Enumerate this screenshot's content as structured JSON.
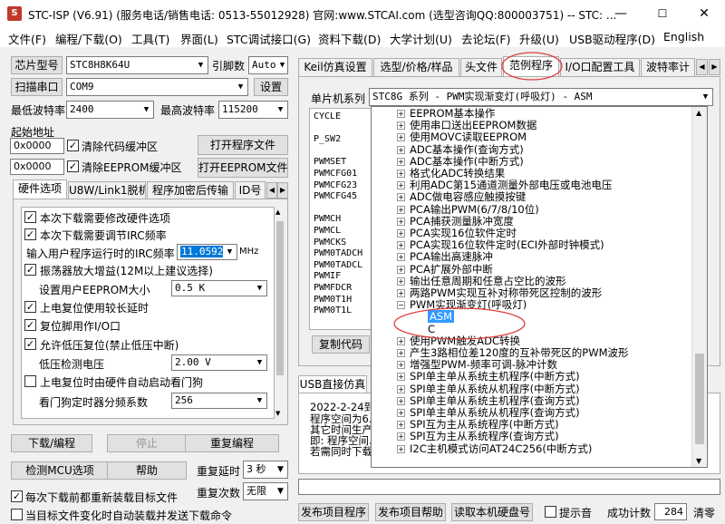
{
  "window": {
    "title": "STC-ISP (V6.91) (服务电话/销售电话: 0513-55012928) 官网:www.STCAI.com  (选型咨询QQ:800003751) -- STC: ...",
    "min": "—",
    "max": "☐",
    "close": "✕"
  },
  "menu": [
    "文件(F)",
    "编程/下载(O)",
    "工具(T)",
    "界面(L)",
    "STC调试接口(G)",
    "资料下载(D)",
    "大学计划(U)",
    "去论坛(F)",
    "升级(U)",
    "USB驱动程序(D)",
    "English"
  ],
  "left": {
    "chip_model_btn": "芯片型号",
    "chip_model": "STC8H8K64U",
    "pin_count_label": "引脚数",
    "pin_count": "Auto",
    "scan_port_btn": "扫描串口",
    "port": "COM9",
    "settings_btn": "设置",
    "min_baud_label": "最低波特率",
    "min_baud": "2400",
    "max_baud_label": "最高波特率",
    "max_baud": "115200",
    "start_addr_label": "起始地址",
    "addr1": "0x0000",
    "clear_code_buf": "清除代码缓冲区",
    "open_prog_btn": "打开程序文件",
    "addr2": "0x0000",
    "clear_eeprom_buf": "清除EEPROM缓冲区",
    "open_eeprom_btn": "打开EEPROM文件",
    "tabs": [
      "硬件选项",
      "U8W/Link1脱机",
      "程序加密后传输",
      "ID号"
    ],
    "hw": {
      "opt1": "本次下载需要修改硬件选项",
      "opt2": "本次下载需要调节IRC频率",
      "irc_label": "输入用户程序运行时的IRC频率",
      "irc_value": "11.0592",
      "irc_unit": "MHz",
      "opt3": "振荡器放大增益(12M以上建议选择)",
      "eeprom_size_label": "设置用户EEPROM大小",
      "eeprom_size": "0.5 K",
      "opt4": "上电复位使用较长延时",
      "opt5": "复位脚用作I/O口",
      "opt6": "允许低压复位(禁止低压中断)",
      "lv_label": "低压检测电压",
      "lv_value": "2.00 V",
      "opt7": "上电复位时由硬件自动启动看门狗",
      "wdt_label": "看门狗定时器分频系数",
      "wdt_value": "256"
    },
    "download_btn": "下载/编程",
    "stop_btn": "停止",
    "reprogram_btn": "重复编程",
    "detect_mcu_btn": "检测MCU选项",
    "help_btn": "帮助",
    "repeat_delay_label": "重复延时",
    "repeat_delay": "3 秒",
    "repeat_count_label": "重复次数",
    "repeat_count": "无限",
    "reload_before_dl": "每次下载前都重新装载目标文件",
    "auto_send_on_change": "当目标文件变化时自动装载并发送下载命令"
  },
  "right": {
    "tabs": [
      "Keil仿真设置",
      "选型/价格/样品",
      "头文件",
      "范例程序",
      "I/O口配置工具",
      "波特率计"
    ],
    "mcu_series_label": "单片机系列",
    "mcu_series_value": "STC8G 系列 - PWM实现渐变灯(呼吸灯) - ASM",
    "registers": [
      "CYCLE",
      "",
      "P_SW2",
      "",
      "PWMSET",
      "PWMCFG01",
      "PWMCFG23",
      "PWMCFG45",
      "",
      "PWMCH",
      "PWMCL",
      "PWMCKS",
      "PWM0TADCH",
      "PWM0TADCL",
      "PWMIF",
      "PWMFDCR",
      "PWM0T1H",
      "PWM0T1L"
    ],
    "copy_code_btn": "复制代码",
    "usb_sim_tab": "USB直接仿真",
    "log_lines": [
      "2022-2-24到...",
      "程序空间为6...",
      "其它时间生产...",
      "即: 程序空间...",
      "若需同时下载..."
    ],
    "tree": [
      {
        "t": "EEPROM基本操作"
      },
      {
        "t": "使用串口送出EEPROM数据"
      },
      {
        "t": "使用MOVC读取EEPROM"
      },
      {
        "t": "ADC基本操作(查询方式)"
      },
      {
        "t": "ADC基本操作(中断方式)"
      },
      {
        "t": "格式化ADC转换结果"
      },
      {
        "t": "利用ADC第15通道测量外部电压或电池电压"
      },
      {
        "t": "ADC做电容感应触摸按键"
      },
      {
        "t": "PCA输出PWM(6/7/8/10位)"
      },
      {
        "t": "PCA捕获测量脉冲宽度"
      },
      {
        "t": "PCA实现16位软件定时"
      },
      {
        "t": "PCA实现16位软件定时(ECI外部时钟模式)"
      },
      {
        "t": "PCA输出高速脉冲"
      },
      {
        "t": "PCA扩展外部中断"
      },
      {
        "t": "输出任意周期和任意占空比的波形"
      },
      {
        "t": "两路PWM实现互补对称带死区控制的波形"
      },
      {
        "t": "PWM实现渐变灯(呼吸灯)",
        "open": true
      },
      {
        "t": "ASM",
        "child": true,
        "sel": true
      },
      {
        "t": "C",
        "child": true
      },
      {
        "t": "使用PWM触发ADC转换"
      },
      {
        "t": "产生3路相位差120度的互补带死区的PWM波形"
      },
      {
        "t": "增强型PWM-频率可调-脉冲计数"
      },
      {
        "t": "SPI单主单从系统主机程序(中断方式)"
      },
      {
        "t": "SPI单主单从系统从机程序(中断方式)"
      },
      {
        "t": "SPI单主单从系统主机程序(查询方式)"
      },
      {
        "t": "SPI单主单从系统从机程序(查询方式)"
      },
      {
        "t": "SPI互为主从系统程序(中断方式)"
      },
      {
        "t": "SPI互为主从系统程序(查询方式)"
      },
      {
        "t": "I2C主机模式访问AT24C256(中断方式)"
      }
    ],
    "publish_prog_btn": "发布项目程序",
    "publish_help_btn": "发布项目帮助",
    "read_serial_btn": "读取本机硬盘号",
    "beep_label": "提示音",
    "success_count_label": "成功计数",
    "success_count": "284",
    "clear_btn": "清零"
  },
  "colors": {
    "accent": "#0078d7",
    "selected": "#3399ff",
    "circle": "#e04040"
  }
}
